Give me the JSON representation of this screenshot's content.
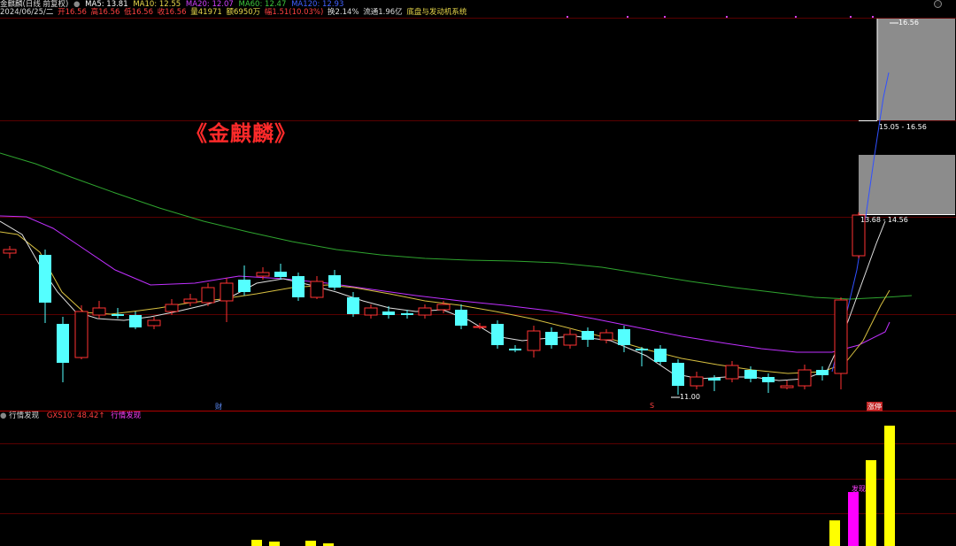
{
  "header": {
    "title": "金麒麟(日线 前复权)",
    "ma_items": [
      {
        "label": "MA5: 13.81",
        "color": "#ffffff"
      },
      {
        "label": "MA10: 12.55",
        "color": "#e8d84a"
      },
      {
        "label": "MA20: 12.07",
        "color": "#d040ff"
      },
      {
        "label": "MA60: 12.47",
        "color": "#3cc83c"
      },
      {
        "label": "MA120: 12.93",
        "color": "#4060ff"
      }
    ]
  },
  "quote_line": {
    "date": "2024/06/25/二",
    "open": "开16.56",
    "high": "高16.56",
    "low": "低16.56",
    "close": "收16.56",
    "volume": "量41971",
    "amount": "额6950万",
    "change": "幅1.51(10.03%)",
    "turnover": "换2.14%",
    "float": "流通1.96亿",
    "system": "底盘与发动机系统"
  },
  "overlay": {
    "banner": "《金麒麟》",
    "high_label": "16.56",
    "low_label": "11.00",
    "range_label_1": "15.05 - 16.56",
    "range_label_2": "13.68 - 14.56",
    "marker_cai": "财",
    "marker_s": "S",
    "marker_zhangting": "涨停"
  },
  "indicator": {
    "name": "行情发现",
    "value_label": "GXS10: 48.42",
    "value_arrow": "↑",
    "series_label": "行情发现",
    "fa_label": "发现"
  },
  "colors": {
    "up": "#ff3232",
    "down": "#54ffff",
    "ma5": "#ffffff",
    "ma10": "#e8d84a",
    "ma20": "#d040ff",
    "ma60": "#3cc83c",
    "ma120": "#4060ff",
    "grid": "#8b0000",
    "vol_bar": "#ffff00",
    "vol_bar_alt": "#ff00ff"
  }
}
